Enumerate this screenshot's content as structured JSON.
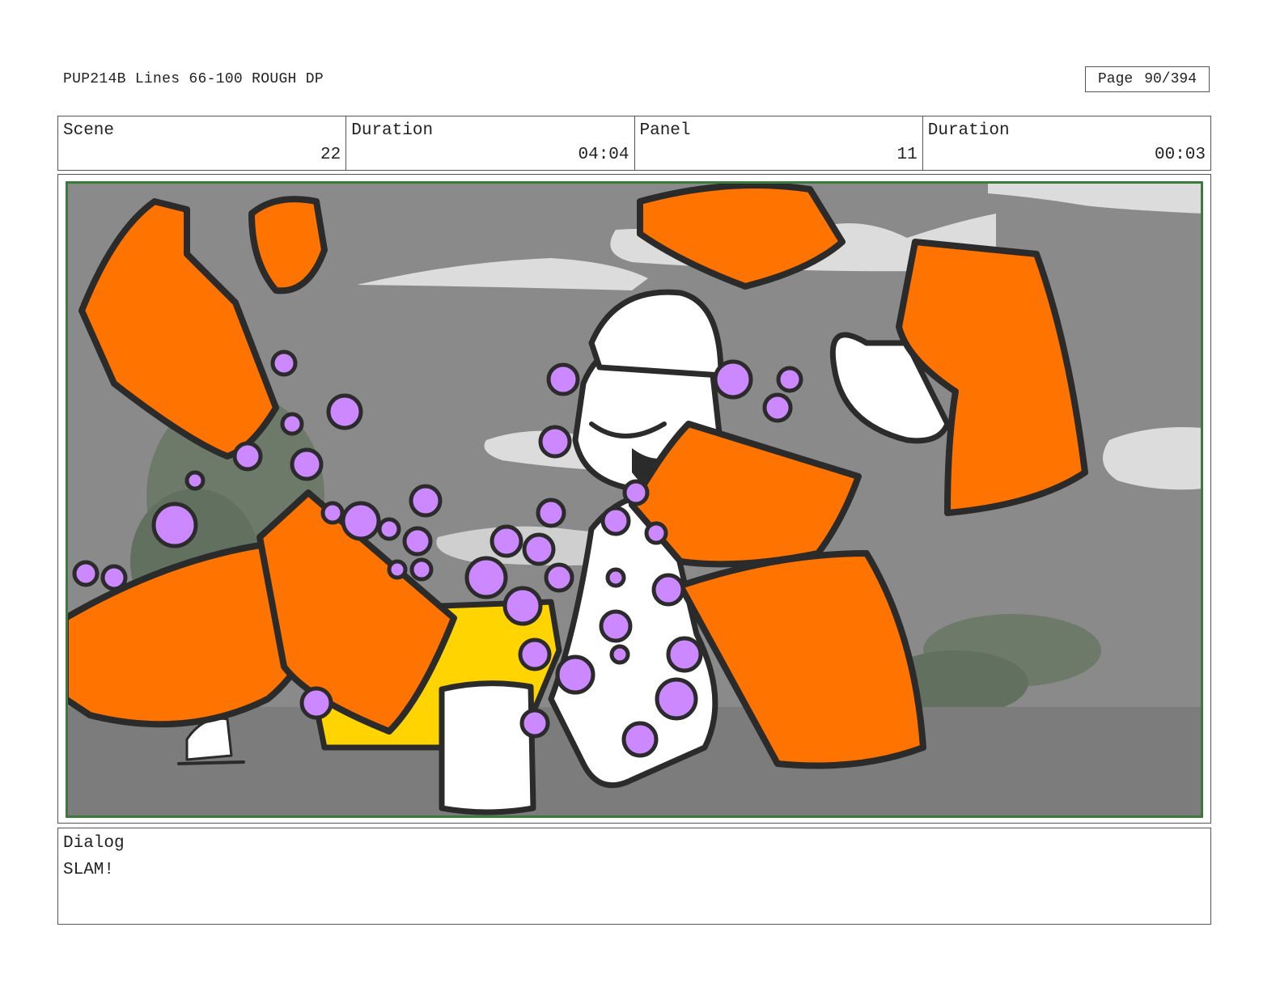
{
  "header": {
    "title": "PUP214B Lines 66-100 ROUGH DP",
    "page_label": "Page",
    "page_number": "90/394"
  },
  "info": [
    {
      "label": "Scene",
      "value": "22"
    },
    {
      "label": "Duration",
      "value": "04:04"
    },
    {
      "label": "Panel",
      "value": "11"
    },
    {
      "label": "Duration",
      "value": "00:03"
    }
  ],
  "panel": {
    "colors": {
      "sky": "#8a8a8a",
      "cloud": "#dcdcdc",
      "crate": "#ff7400",
      "berry": "#cc88ff",
      "bin": "#ffd400",
      "outline": "#2b2b2b",
      "frame": "#3a7a3a",
      "bush": "#6d7a6a"
    }
  },
  "dialog": {
    "label": "Dialog",
    "text": "SLAM!"
  }
}
